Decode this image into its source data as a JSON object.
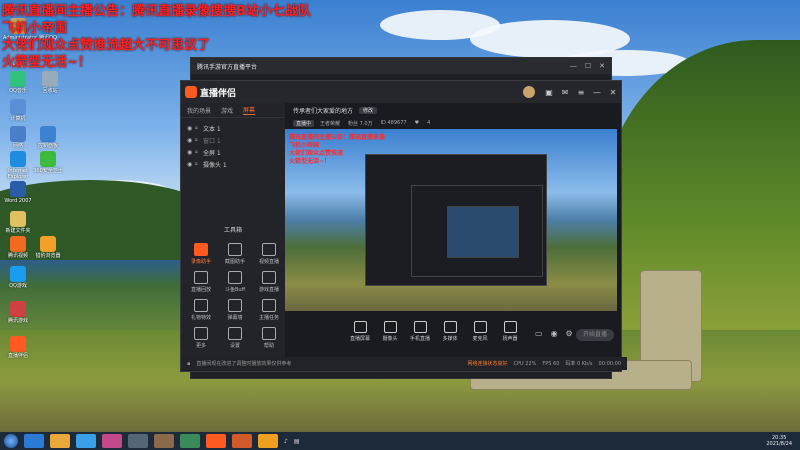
{
  "overlay_text": {
    "line1": "腾讯直播间主播公告：腾讯直播录像搜搜B站小七战队",
    "line2": "飞机小帝国",
    "line3": "大佬们观众点赞推流超大不可思议了",
    "line4": "火箭型无活~！"
  },
  "desktop_icons": [
    {
      "label": "Administrator",
      "color": "#c8a560"
    },
    {
      "label": "腾讯QQ",
      "color": "#1a9cf0"
    },
    {
      "label": "计算机",
      "color": "#6a9ad0"
    },
    {
      "label": "QQ音乐",
      "color": "#31c27c"
    },
    {
      "label": "回收站",
      "color": "#9ab"
    },
    {
      "label": "计算机",
      "color": "#5b8ed6"
    },
    {
      "label": "网络",
      "color": "#4a7ec8"
    },
    {
      "label": "控制面板",
      "color": "#3b82d1"
    },
    {
      "label": "Internet Explorer",
      "color": "#1e8de0"
    },
    {
      "label": "Word 2007",
      "color": "#2b5ca8"
    },
    {
      "label": "360安全卫士",
      "color": "#3dbb3d"
    },
    {
      "label": "新建文件夹",
      "color": "#e0c060"
    },
    {
      "label": "腾讯视频",
      "color": "#f06a20"
    },
    {
      "label": "猎豹浏览器",
      "color": "#f2a02a"
    },
    {
      "label": "QQ游戏",
      "color": "#1a9cf0"
    },
    {
      "label": "腾讯游戏",
      "color": "#d04040"
    },
    {
      "label": "直播伴侣",
      "color": "#ff5a1f"
    }
  ],
  "back_window": {
    "title": "腾讯手游官方直播平台"
  },
  "app": {
    "logo": "直播伴侣",
    "tabs": [
      "我的场景",
      "游戏",
      "屏幕"
    ],
    "active_tab": "屏幕",
    "scenes": [
      {
        "name": "文本 1",
        "muted": false
      },
      {
        "name": "窗口 1",
        "muted": true
      },
      {
        "name": "全屏 1",
        "muted": false
      },
      {
        "name": "摄像头 1",
        "muted": false
      }
    ],
    "tools_title": "工具箱",
    "tools": [
      {
        "label": "录像助手",
        "highlight": true
      },
      {
        "label": "截图助手",
        "highlight": false
      },
      {
        "label": "视频直播",
        "highlight": false
      },
      {
        "label": "直播回放",
        "highlight": false
      },
      {
        "label": "斗鱼Buff",
        "highlight": false
      },
      {
        "label": "游戏直播",
        "highlight": false
      },
      {
        "label": "礼物特效",
        "highlight": false
      },
      {
        "label": "弹幕墙",
        "highlight": false
      },
      {
        "label": "主播任务",
        "highlight": false
      },
      {
        "label": "更多",
        "highlight": false
      },
      {
        "label": "设置",
        "highlight": false
      },
      {
        "label": "帮助",
        "highlight": false
      }
    ],
    "room_title": "传承者们大家爱的地方",
    "room_chip": "修改",
    "info": {
      "badge": "直播中",
      "category": "王者荣耀",
      "fans": "粉丝 7.0万",
      "id": "ID 489677",
      "likes": "4"
    },
    "preview_text": [
      "腾讯直播间主播公告：腾讯直播录像",
      "飞机小帝国",
      "大佬们观众点赞推流",
      "火箭型无活~！"
    ],
    "bottom_tools": [
      {
        "label": "直播屏幕"
      },
      {
        "label": "摄像头"
      },
      {
        "label": "手机直播"
      },
      {
        "label": "多媒体"
      },
      {
        "label": "麦克风"
      },
      {
        "label": "扬声器"
      }
    ],
    "start_label": "开始直播",
    "status": {
      "notice": "直播间现在改进了调整时播放效果仅供参考",
      "upload": "网络连接状态良好",
      "cpu": "CPU 22%",
      "fps": "FPS 60",
      "bitrate": "码率 0 Kb/s",
      "time": "00:00:00"
    }
  },
  "taskbar": {
    "time": "20:35",
    "date": "2021/8/24",
    "apps": [
      {
        "color": "#2a7ad6"
      },
      {
        "color": "#e8a83a"
      },
      {
        "color": "#3aa0e8"
      },
      {
        "color": "#c34a8a"
      },
      {
        "color": "#556677"
      },
      {
        "color": "#8a6a4a"
      },
      {
        "color": "#3a8a5a"
      },
      {
        "color": "#ff5a1f"
      },
      {
        "color": "#d05a2a"
      },
      {
        "color": "#f0a020"
      }
    ]
  }
}
